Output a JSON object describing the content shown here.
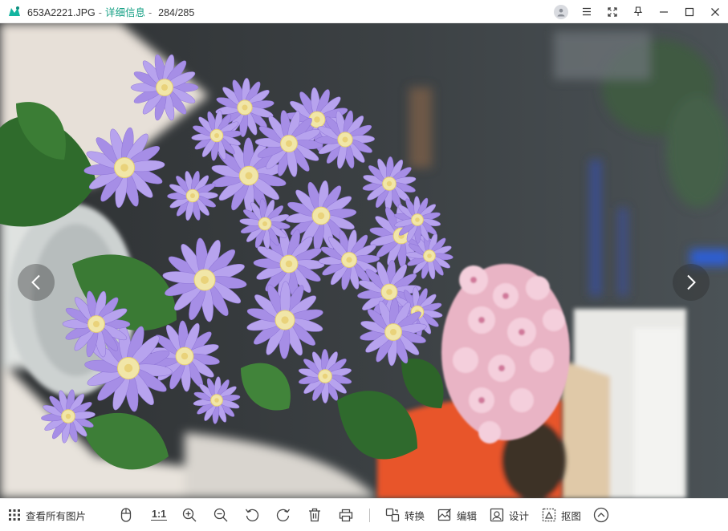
{
  "titlebar": {
    "filename": "653A2221.JPG",
    "separator": "-",
    "details_link": "详细信息",
    "counter": "284/285"
  },
  "toolbar": {
    "view_all_label": "查看所有图片",
    "actual_size_label": "1:1",
    "convert_label": "转换",
    "edit_label": "编辑",
    "design_label": "设计",
    "cutout_label": "抠图"
  },
  "colors": {
    "accent": "#16a085",
    "toolbar_icon": "#444444"
  }
}
